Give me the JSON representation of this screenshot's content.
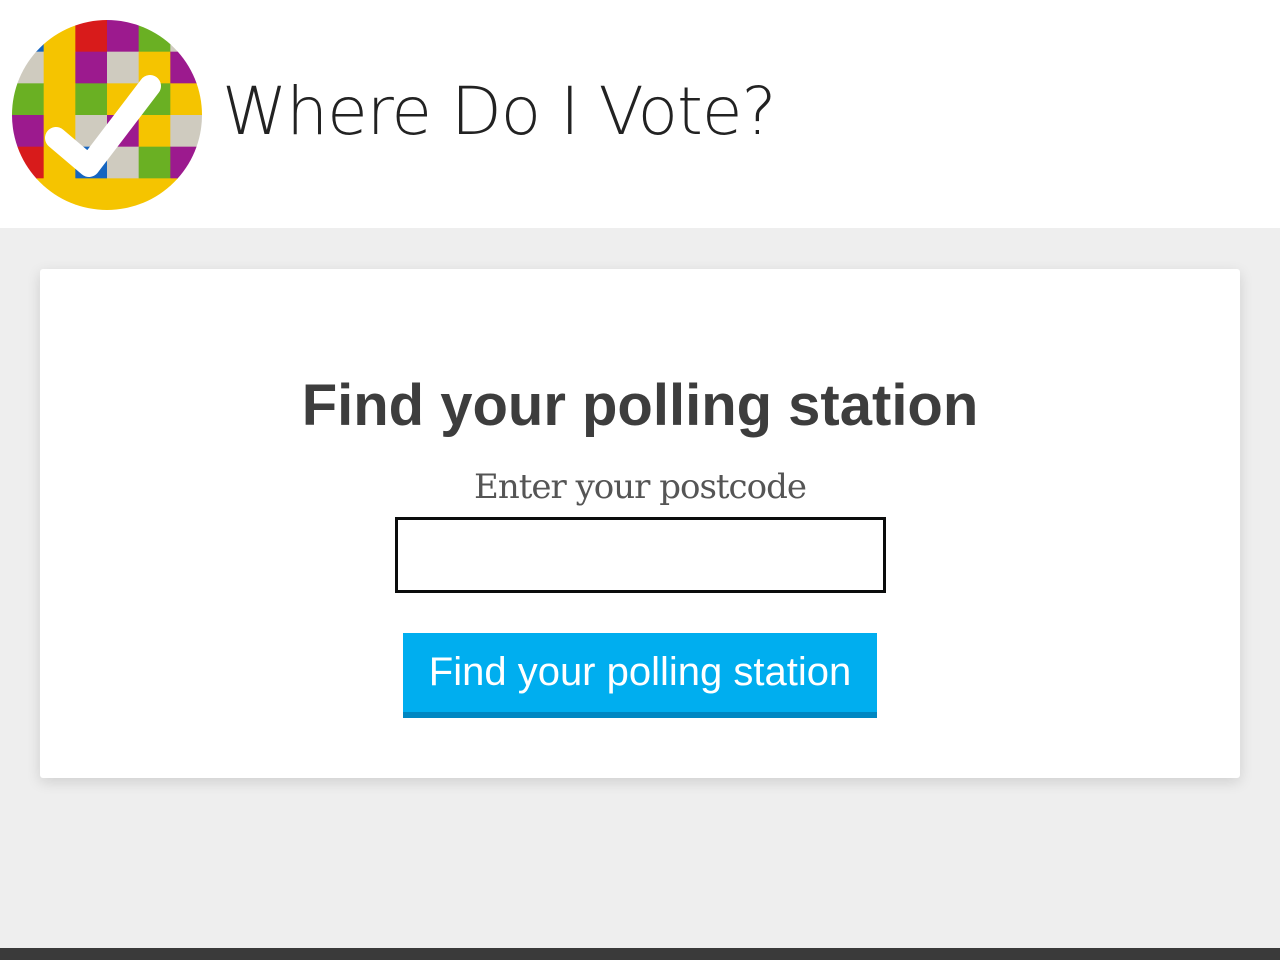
{
  "header": {
    "site_title": "Where Do I Vote?",
    "logo_icon": "checkmark-mosaic-logo"
  },
  "search": {
    "heading": "Find your polling station",
    "postcode_label": "Enter your postcode",
    "postcode_value": "",
    "postcode_placeholder": "",
    "submit_label": "Find your polling station"
  },
  "colors": {
    "button_bg": "#00aeef",
    "button_border": "#0087c2",
    "page_bg": "#eeeeee",
    "footer": "#3a3a3a",
    "logo_palette": [
      "#1565c0",
      "#f5c400",
      "#d81b1b",
      "#9c1a8e",
      "#6ab023",
      "#cfcbbf"
    ]
  }
}
